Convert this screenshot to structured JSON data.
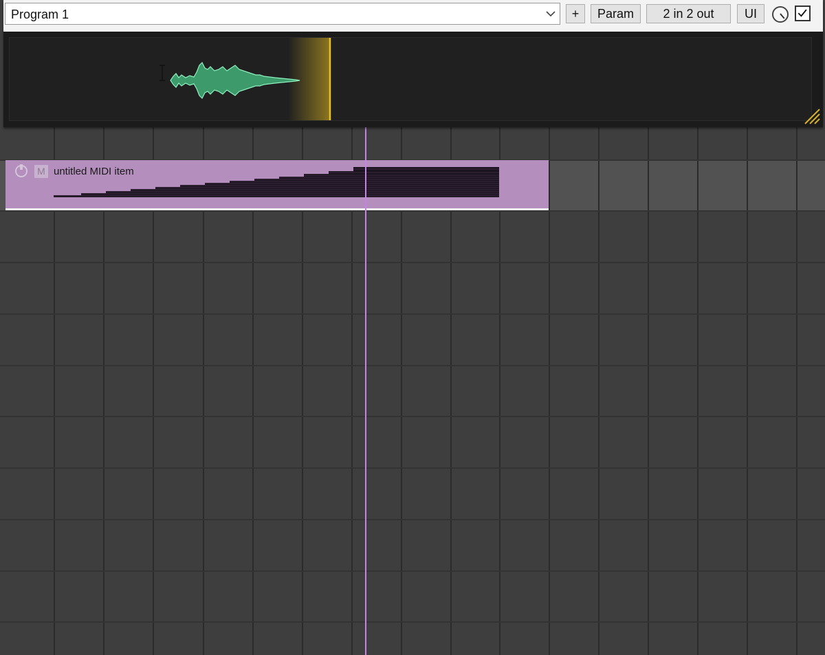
{
  "plugin": {
    "program": "Program 1",
    "add_label": "+",
    "param_label": "Param",
    "io_label": "2 in 2 out",
    "ui_label": "UI",
    "bypass_checked": true,
    "icons": {
      "dropdown": "chevron-down-icon",
      "wet": "knob-icon",
      "resize": "resize-grip-icon"
    }
  },
  "item": {
    "name": "untitled MIDI item",
    "mute_label": "M",
    "color": "#b48fbd"
  },
  "colors": {
    "playhead": "#c782e8",
    "grid_background": "#3e3e3e",
    "track_lane": "#525252",
    "scope_cursor": "#e8c020",
    "waveform": "#3d9a6a"
  }
}
